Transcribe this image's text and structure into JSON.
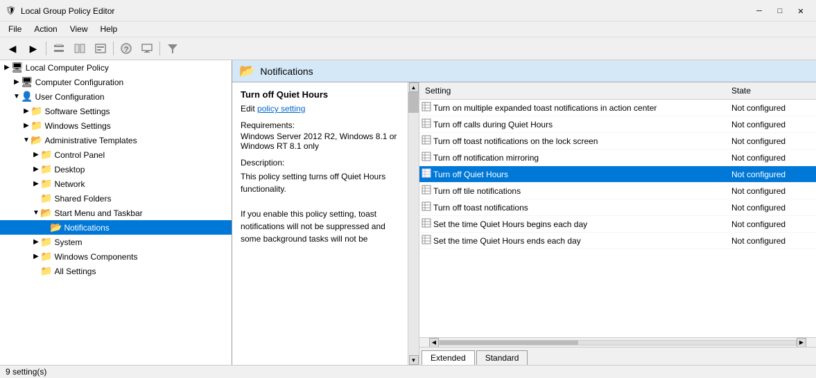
{
  "window": {
    "title": "Local Group Policy Editor",
    "icon": "🛡"
  },
  "titlebar": {
    "minimize": "─",
    "maximize": "□",
    "close": "✕"
  },
  "menubar": {
    "items": [
      "File",
      "Action",
      "View",
      "Help"
    ]
  },
  "toolbar": {
    "buttons": [
      "◀",
      "▶",
      "📁",
      "📄",
      "📋",
      "❓",
      "🖥",
      "▼"
    ]
  },
  "tree": {
    "root": "Local Computer Policy",
    "items": [
      {
        "label": "Computer Configuration",
        "level": 1,
        "expanded": false,
        "icon": "🖥"
      },
      {
        "label": "User Configuration",
        "level": 1,
        "expanded": true,
        "icon": "👤"
      },
      {
        "label": "Software Settings",
        "level": 2,
        "expanded": false,
        "icon": "📁"
      },
      {
        "label": "Windows Settings",
        "level": 2,
        "expanded": false,
        "icon": "📁"
      },
      {
        "label": "Administrative Templates",
        "level": 2,
        "expanded": true,
        "icon": "📁"
      },
      {
        "label": "Control Panel",
        "level": 3,
        "expanded": false,
        "icon": "📁"
      },
      {
        "label": "Desktop",
        "level": 3,
        "expanded": false,
        "icon": "📁"
      },
      {
        "label": "Network",
        "level": 3,
        "expanded": false,
        "icon": "📁"
      },
      {
        "label": "Shared Folders",
        "level": 3,
        "expanded": false,
        "icon": "📁"
      },
      {
        "label": "Start Menu and Taskbar",
        "level": 3,
        "expanded": true,
        "icon": "📁"
      },
      {
        "label": "Notifications",
        "level": 4,
        "expanded": false,
        "icon": "📂",
        "selected": true
      },
      {
        "label": "System",
        "level": 3,
        "expanded": false,
        "icon": "📁"
      },
      {
        "label": "Windows Components",
        "level": 3,
        "expanded": false,
        "icon": "📁"
      },
      {
        "label": "All Settings",
        "level": 3,
        "expanded": false,
        "icon": "📁"
      }
    ]
  },
  "content_header": {
    "icon": "📂",
    "title": "Notifications"
  },
  "description": {
    "title": "Turn off Quiet Hours",
    "edit_label": "Edit",
    "edit_link_text": "policy setting",
    "requirements_label": "Requirements:",
    "requirements_value": "Windows Server 2012 R2, Windows 8.1 or Windows RT 8.1 only",
    "description_label": "Description:",
    "description_text": "This policy setting turns off Quiet Hours functionality.\n\nIf you enable this policy setting, toast notifications will not be suppressed and some background tasks will not be"
  },
  "settings": {
    "col_setting": "Setting",
    "col_state": "State",
    "rows": [
      {
        "name": "Turn on multiple expanded toast notifications in action center",
        "state": "Not configured",
        "selected": false
      },
      {
        "name": "Turn off calls during Quiet Hours",
        "state": "Not configured",
        "selected": false
      },
      {
        "name": "Turn off toast notifications on the lock screen",
        "state": "Not configured",
        "selected": false
      },
      {
        "name": "Turn off notification mirroring",
        "state": "Not configured",
        "selected": false
      },
      {
        "name": "Turn off Quiet Hours",
        "state": "Not configured",
        "selected": true
      },
      {
        "name": "Turn off tile notifications",
        "state": "Not configured",
        "selected": false
      },
      {
        "name": "Turn off toast notifications",
        "state": "Not configured",
        "selected": false
      },
      {
        "name": "Set the time Quiet Hours begins each day",
        "state": "Not configured",
        "selected": false
      },
      {
        "name": "Set the time Quiet Hours ends each day",
        "state": "Not configured",
        "selected": false
      }
    ]
  },
  "tabs": [
    {
      "label": "Extended",
      "active": true
    },
    {
      "label": "Standard",
      "active": false
    }
  ],
  "statusbar": {
    "text": "9 setting(s)"
  }
}
